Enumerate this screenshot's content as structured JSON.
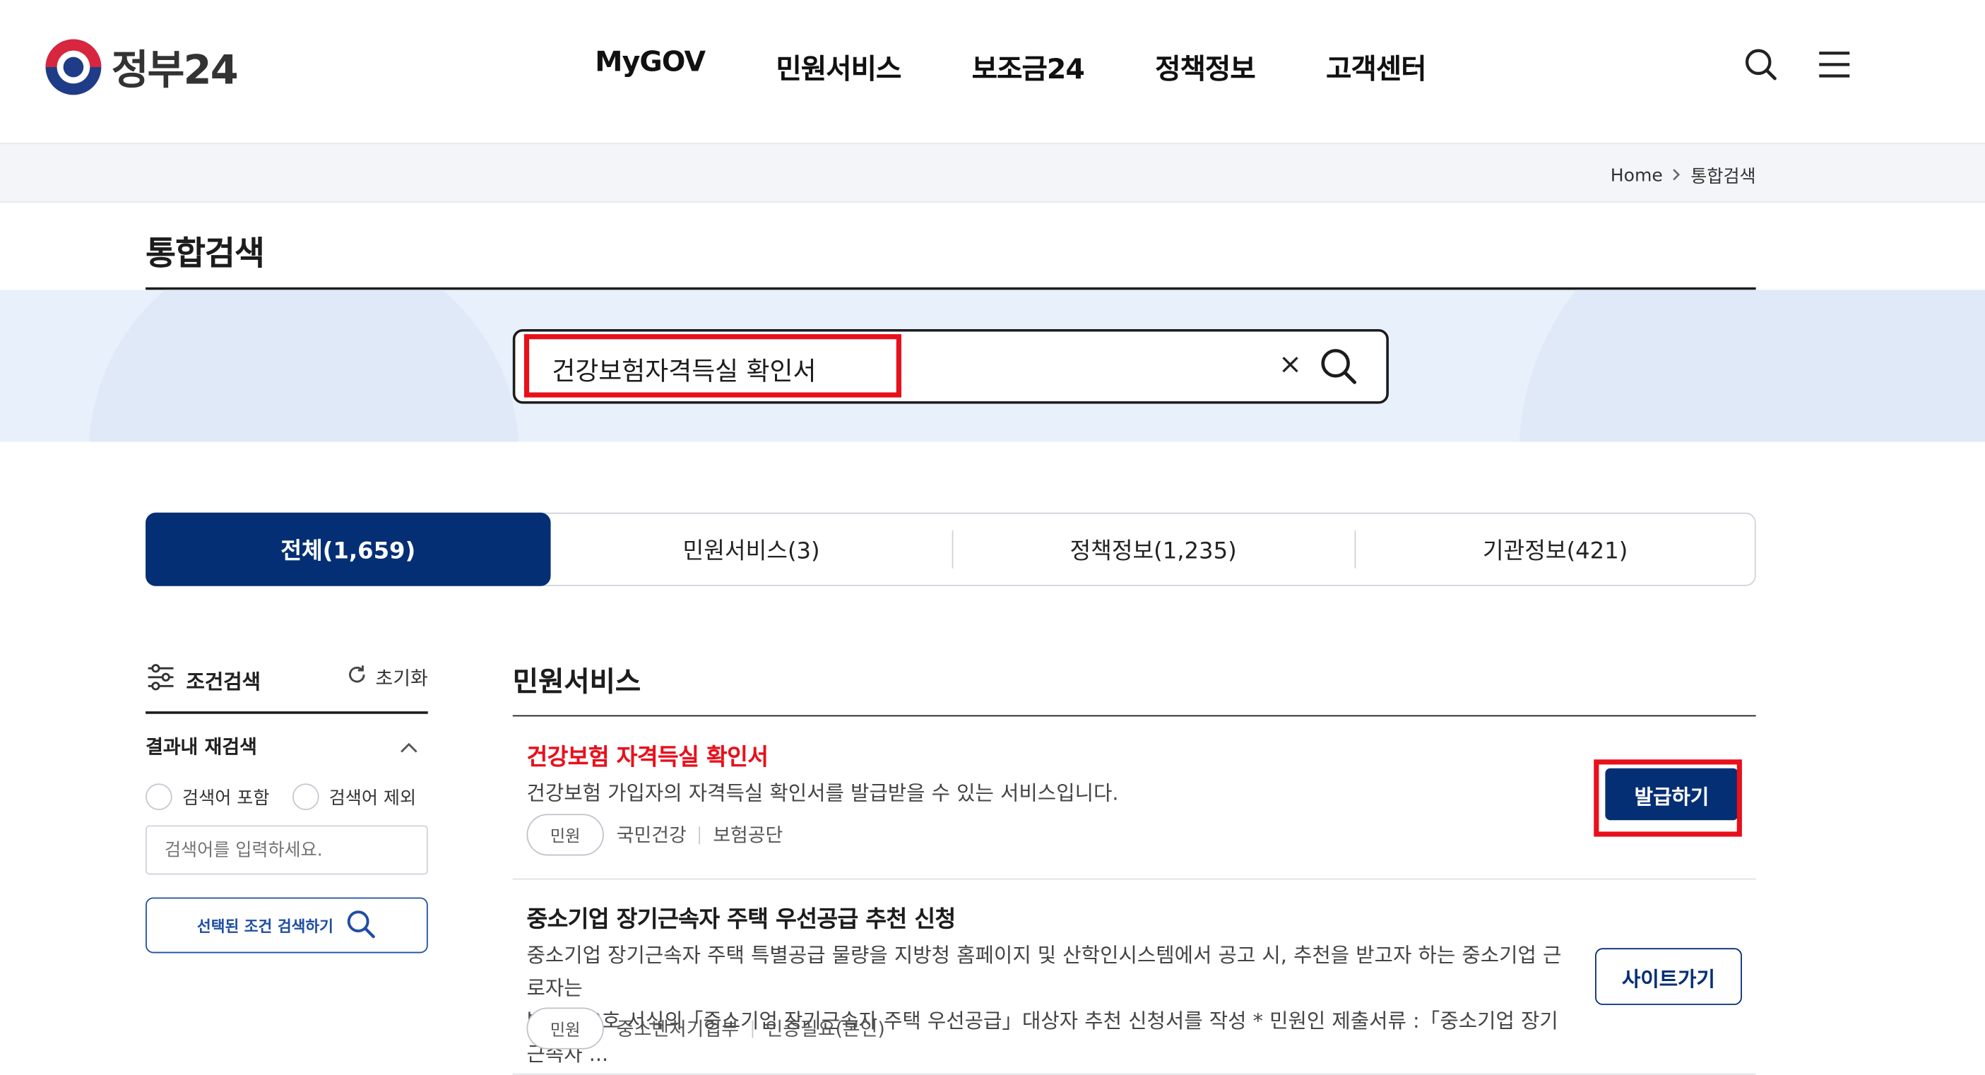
{
  "header": {
    "logo_text": "정부24",
    "nav": [
      "MyGOV",
      "민원서비스",
      "보조금24",
      "정책정보",
      "고객센터"
    ],
    "icons": [
      "search-icon",
      "menu-icon"
    ]
  },
  "breadcrumb": {
    "home": "Home",
    "current": "통합검색"
  },
  "page_title": "통합검색",
  "search": {
    "query": "건강보험자격득실 확인서",
    "clear_label": "×"
  },
  "tabs": [
    {
      "label": "전체(1,659)",
      "active": true
    },
    {
      "label": "민원서비스(3)",
      "active": false
    },
    {
      "label": "정책정보(1,235)",
      "active": false
    },
    {
      "label": "기관정보(421)",
      "active": false
    }
  ],
  "filter": {
    "title": "조건검색",
    "reset": "초기화",
    "subhead": "결과내 재검색",
    "include": "검색어 포함",
    "exclude": "검색어 제외",
    "placeholder": "검색어를 입력하세요.",
    "submit": "선택된 조건 검색하기"
  },
  "results": {
    "section_title": "민원서비스",
    "items": [
      {
        "title": "건강보험 자격득실 확인서",
        "desc": "건강보험 가입자의 자격득실 확인서를 발급받을 수 있는 서비스입니다.",
        "chip": "민원",
        "meta": [
          "국민건강",
          "보험공단"
        ],
        "button": "발급하기",
        "accent": "#e8101b"
      },
      {
        "title": "중소기업 장기근속자 주택 우선공급 추천 신청",
        "desc_line1": "중소기업 장기근속자 주택 특별공급 물량을 지방청 홈페이지 및 산학인시스템에서 공고 시, 추천을 받고자 하는 중소기업 근로자는",
        "desc_line2": "별지 제2호 서식의「중소기업 장기근속자 주택 우선공급」대상자 추천 신청서를 작성 * 민원인 제출서류 :「중소기업 장기근속자 ...",
        "chip": "민원",
        "meta": [
          "중소벤처기업부",
          "인증필요(본인)"
        ],
        "button": "사이트가기"
      }
    ]
  },
  "colors": {
    "primary": "#042f74",
    "highlight": "#e8101b",
    "band": "#e8f0fb"
  }
}
